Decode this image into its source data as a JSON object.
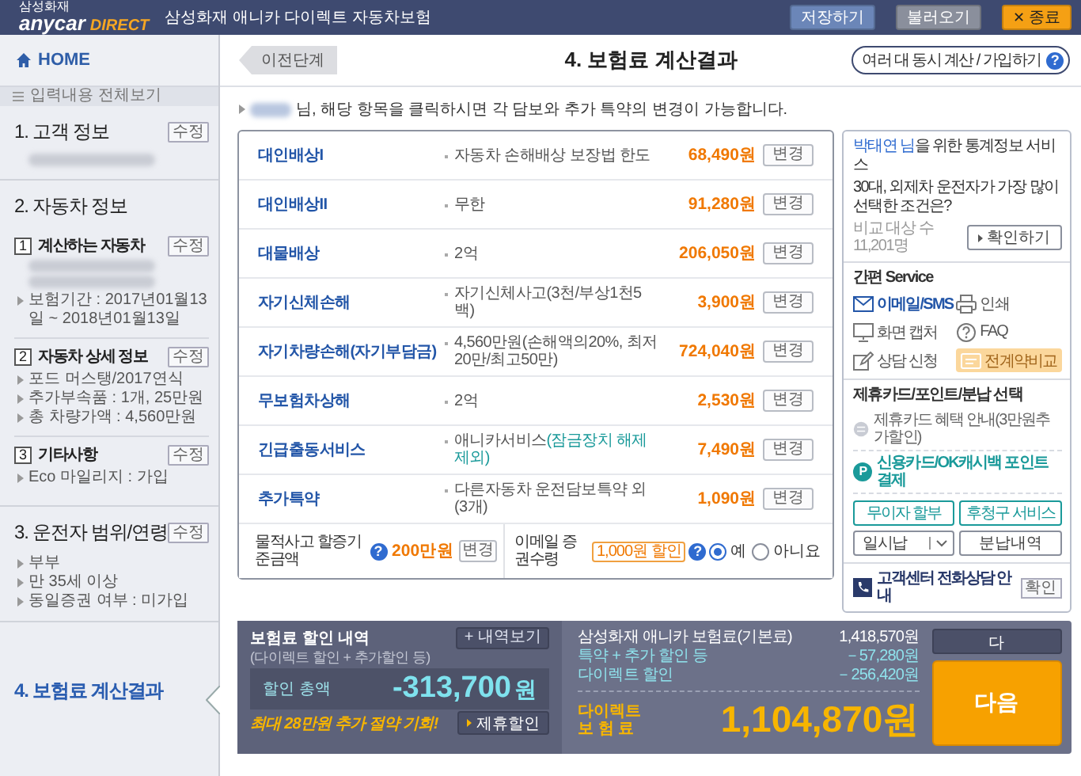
{
  "header": {
    "brand_small": "삼성화재",
    "brand": "anycar",
    "brand_suffix": "DIRECT",
    "title": "삼성화재 애니카 다이렉트 자동차보험",
    "buttons": [
      {
        "label": "저장하기",
        "kind": "save"
      },
      {
        "label": "불러오기",
        "kind": "load"
      },
      {
        "label": "종료",
        "kind": "exit",
        "icon": "✕"
      }
    ]
  },
  "sidebar": {
    "home": "HOME",
    "overview": "입력내용 전체보기",
    "sections": [
      {
        "title": "1. 고객 정보",
        "edit": "수정",
        "selected": false,
        "items": [
          {
            "kind": "blurred"
          }
        ]
      },
      {
        "title": "2. 자동차 정보",
        "selected": false,
        "groups": [
          {
            "number": "1",
            "title": "계산하는 자동차",
            "edit": "수정",
            "items": [
              {
                "kind": "blurred"
              },
              {
                "kind": "blurred"
              },
              {
                "kind": "text",
                "text": "보험기간 : 2017년01월13일 ~ 2018년01월13일"
              }
            ]
          },
          {
            "number": "2",
            "title": "자동차 상세 정보",
            "edit": "수정",
            "items": [
              {
                "kind": "text",
                "text": "포드 머스탱/2017연식"
              },
              {
                "kind": "text",
                "text": "추가부속품 : 1개, 25만원"
              },
              {
                "kind": "text",
                "text": "총 차량가액 : 4,560만원"
              }
            ]
          },
          {
            "number": "3",
            "title": "기타사항",
            "edit": "수정",
            "items": [
              {
                "kind": "text",
                "text": "Eco 마일리지 : 가입"
              }
            ]
          }
        ]
      },
      {
        "title": "3. 운전자 범위/연령",
        "edit": "수정",
        "selected": false,
        "items": [
          {
            "kind": "text",
            "text": "부부"
          },
          {
            "kind": "text",
            "text": "만 35세 이상"
          },
          {
            "kind": "text",
            "text": "동일증권 여부 : 미가입"
          }
        ]
      },
      {
        "title": "4. 보험료 계산결과",
        "selected": true
      }
    ]
  },
  "page": {
    "back": "이전단계",
    "title": "4. 보험료 계산결과",
    "multi": "여러 대 동시 계산 / 가입하기",
    "multi_icon": "?"
  },
  "notice": {
    "name_hidden": true,
    "text": "님, 해당 항목을 클릭하시면 각 담보와 추가 특약의 변경이 가능합니다."
  },
  "coverages": [
    {
      "name": "대인배상I",
      "detail": "자동차 손해배상 보장법 한도",
      "price": "68,490원",
      "button": "변경"
    },
    {
      "name": "대인배상II",
      "detail": "무한",
      "price": "91,280원",
      "button": "변경"
    },
    {
      "name": "대물배상",
      "detail": "2억",
      "price": "206,050원",
      "button": "변경"
    },
    {
      "name": "자기신체손해",
      "detail": "자기신체사고(3천/부상1천5백)",
      "price": "3,900원",
      "button": "변경"
    },
    {
      "name": "자기차량손해(자기부담금)",
      "detail": "4,560만원(손해액의20%, 최저20만/최고50만)",
      "price": "724,040원",
      "button": "변경"
    },
    {
      "name": "무보험차상해",
      "detail": "2억",
      "price": "2,530원",
      "button": "변경"
    },
    {
      "name": "긴급출동서비스",
      "detail": "애니카서비스",
      "detail_note": "(잠금장치 해제 제외)",
      "price": "7,490원",
      "button": "변경"
    },
    {
      "name": "추가특약",
      "detail": "다른자동차 운전담보특약 외 (3개)",
      "price": "1,090원",
      "button": "변경"
    }
  ],
  "options": {
    "property_label": "물적사고 할증기준금액",
    "property_help": "?",
    "property_value": "200만원",
    "property_button": "변경",
    "email_label": "이메일 증권수령",
    "email_badge": "1,000원 할인",
    "email_help": "?",
    "radios": [
      {
        "label": "예",
        "selected": true
      },
      {
        "label": "아니요",
        "selected": false
      }
    ]
  },
  "stats": {
    "name": "박태연 님",
    "title": "을 위한 통계정보 서비스",
    "question": "30대, 외제차 운전자가 가장 많이 선택한 조건은?",
    "count_label": "비교 대상 수",
    "count": "11,201명",
    "button": "확인하기"
  },
  "quick_service": {
    "title": "간편 Service",
    "items": [
      {
        "label": "이메일/SMS",
        "kind": "mail",
        "selected": true
      },
      {
        "label": "인쇄",
        "kind": "print",
        "selected": false
      },
      {
        "label": "화면 캡처",
        "kind": "monitor",
        "selected": false
      },
      {
        "label": "FAQ",
        "kind": "faq",
        "selected": false
      },
      {
        "label": "상담 신청",
        "kind": "memo",
        "selected": false
      },
      {
        "label": "전계약비교",
        "kind": "compare",
        "selected": false
      }
    ]
  },
  "payment": {
    "title": "제휴카드/포인트/분납 선택",
    "links": [
      {
        "label": "제휴카드 혜택 안내(3만원추가할인)",
        "kind": "card"
      },
      {
        "label": "신용카드/OK캐시백 포인트 결제",
        "kind": "point",
        "badge": "P"
      }
    ],
    "buttons": [
      "무이자 할부",
      "후청구 서비스"
    ],
    "installment": "일시납",
    "installment_button": "분납내역"
  },
  "contact": {
    "label": "고객센터 전화상담 안내",
    "button": "확인"
  },
  "summary": {
    "title": "보험료 할인 내역",
    "subtitle": "(다이렉트 할인 + 추가할인 등)",
    "details_button": "+ 내역보기",
    "total_label": "할인 총액",
    "total_value": "-313,700",
    "total_unit": "원",
    "promo": "최대 28만원 추가 절약 기회!",
    "partner_button": "제휴할인",
    "lines": [
      {
        "label": "삼성화재 애니카 보험료(기본료)",
        "value": "1,418,570원",
        "kind": "base"
      },
      {
        "label": "특약 + 추가 할인 등",
        "value": "－57,280원",
        "kind": "discount"
      },
      {
        "label": "다이렉트 할인",
        "value": "－256,420원",
        "kind": "discount"
      }
    ],
    "final_label": [
      "다이렉트",
      "보 험 료"
    ],
    "final_value": "1,104,870원",
    "actions": [
      {
        "label": "다",
        "kind": "secondary"
      },
      {
        "label": "다음",
        "kind": "primary"
      }
    ]
  }
}
